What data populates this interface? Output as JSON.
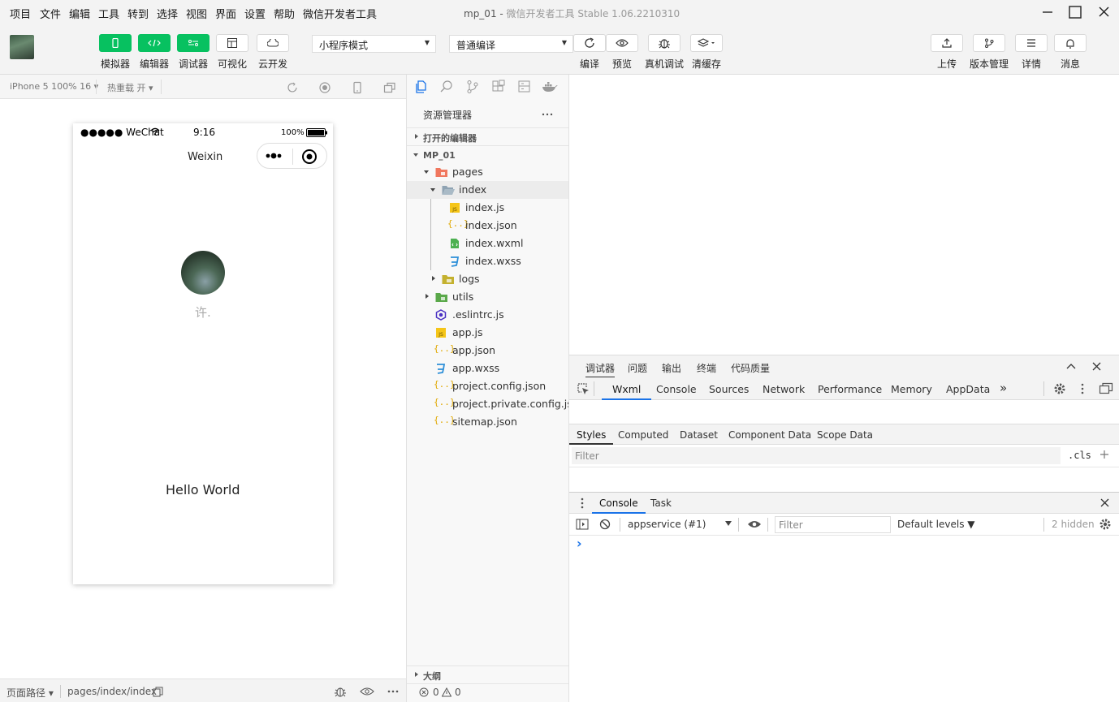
{
  "menu": [
    "项目",
    "文件",
    "编辑",
    "工具",
    "转到",
    "选择",
    "视图",
    "界面",
    "设置",
    "帮助",
    "微信开发者工具"
  ],
  "window": {
    "title": "mp_01",
    "subtitle": "微信开发者工具 Stable 1.06.2210310"
  },
  "toolbar": {
    "left_buttons": [
      {
        "label": "模拟器",
        "icon": "phone-icon"
      },
      {
        "label": "编辑器",
        "icon": "code-icon"
      },
      {
        "label": "调试器",
        "icon": "debug-toggle-icon"
      },
      {
        "label": "可视化",
        "icon": "layout-icon"
      },
      {
        "label": "云开发",
        "icon": "cloud-icon"
      }
    ],
    "mode_select": "小程序模式",
    "compile_select": "普通编译",
    "mid_buttons": [
      {
        "label": "编译",
        "icon": "refresh-icon"
      },
      {
        "label": "预览",
        "icon": "eye-icon"
      },
      {
        "label": "真机调试",
        "icon": "bug-icon"
      },
      {
        "label": "清缓存",
        "icon": "layers-icon"
      }
    ],
    "right_buttons": [
      {
        "label": "上传",
        "icon": "upload-icon"
      },
      {
        "label": "版本管理",
        "icon": "branch-icon"
      },
      {
        "label": "详情",
        "icon": "menu-icon"
      },
      {
        "label": "消息",
        "icon": "bell-icon"
      }
    ]
  },
  "simulator": {
    "device": "iPhone 5 100% 16",
    "hot_reload": "热重载 开",
    "status_left": "●●●●● WeChat",
    "time": "9:16",
    "battery": "100%",
    "nav_title": "Weixin",
    "username": "许.",
    "hello": "Hello World",
    "footer_path_label": "页面路径",
    "footer_path": "pages/index/index"
  },
  "explorer": {
    "title": "资源管理器",
    "open_editors": "打开的编辑器",
    "project": "MP_01",
    "outline": "大纲",
    "tree": [
      {
        "name": "pages",
        "type": "folder-open",
        "depth": 1,
        "arrow": "down"
      },
      {
        "name": "index",
        "type": "folder-open-gray",
        "depth": 2,
        "arrow": "down",
        "selected": true
      },
      {
        "name": "index.js",
        "type": "js",
        "depth": 3
      },
      {
        "name": "index.json",
        "type": "json",
        "depth": 3
      },
      {
        "name": "index.wxml",
        "type": "wxml",
        "depth": 3
      },
      {
        "name": "index.wxss",
        "type": "wxss",
        "depth": 3
      },
      {
        "name": "logs",
        "type": "folder",
        "depth": 2,
        "arrow": "right"
      },
      {
        "name": "utils",
        "type": "folder-green",
        "depth": 1,
        "arrow": "right"
      },
      {
        "name": ".eslintrc.js",
        "type": "eslint",
        "depth": 1
      },
      {
        "name": "app.js",
        "type": "js",
        "depth": 1
      },
      {
        "name": "app.json",
        "type": "json",
        "depth": 1
      },
      {
        "name": "app.wxss",
        "type": "wxss",
        "depth": 1
      },
      {
        "name": "project.config.json",
        "type": "json",
        "depth": 1
      },
      {
        "name": "project.private.config.js...",
        "type": "json",
        "depth": 1
      },
      {
        "name": "sitemap.json",
        "type": "json",
        "depth": 1
      }
    ],
    "status_errors": "0",
    "status_warnings": "0"
  },
  "devtools": {
    "top_tabs": [
      "调试器",
      "问题",
      "输出",
      "终端",
      "代码质量"
    ],
    "panel_tabs": [
      "Wxml",
      "Console",
      "Sources",
      "Network",
      "Performance",
      "Memory",
      "AppData"
    ],
    "more": "»",
    "style_tabs": [
      "Styles",
      "Computed",
      "Dataset",
      "Component Data",
      "Scope Data"
    ],
    "filter_placeholder": "Filter",
    "cls": ".cls",
    "console_tabs": [
      "Console",
      "Task"
    ],
    "context": "appservice (#1)",
    "console_filter": "Filter",
    "levels": "Default levels",
    "hidden": "2 hidden",
    "prompt": "›"
  }
}
